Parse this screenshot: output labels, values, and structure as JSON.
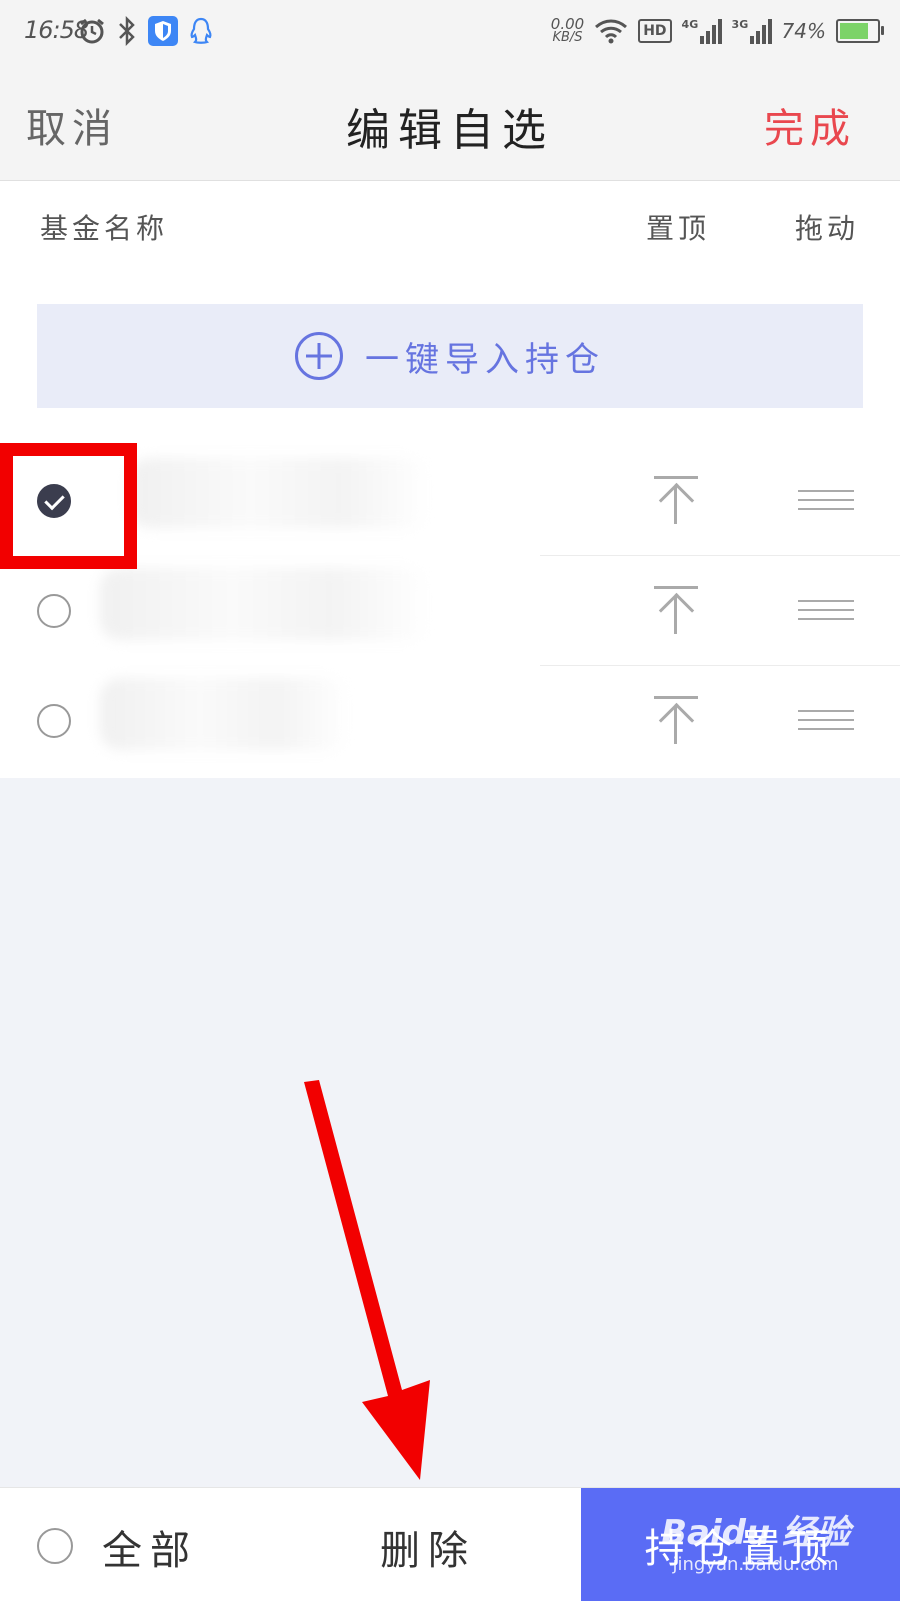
{
  "status_bar": {
    "time": "16:58",
    "net_speed_value": "0.00",
    "net_speed_unit": "KB/S",
    "hd_label": "HD",
    "signal1_label": "4G",
    "signal2_label": "3G",
    "battery_percent": "74%",
    "battery_level": 0.74,
    "icons": [
      "alarm-icon",
      "bluetooth-icon",
      "shield-app-icon",
      "qq-icon",
      "wifi-icon",
      "battery-icon"
    ]
  },
  "header": {
    "cancel_label": "取消",
    "title": "编辑自选",
    "done_label": "完成",
    "done_color": "#e9474e"
  },
  "columns": {
    "name": "基金名称",
    "pin_top": "置顶",
    "drag": "拖动"
  },
  "import_button": {
    "label": "一键导入持仓",
    "icon": "plus-circle-icon",
    "color": "#6674e0"
  },
  "rows": [
    {
      "checked": true
    },
    {
      "checked": false
    },
    {
      "checked": false
    }
  ],
  "bottom_bar": {
    "select_all_label": "全部",
    "delete_label": "删除",
    "primary_label": "持仓置顶",
    "primary_color": "#5a6cf5"
  },
  "annotations": {
    "highlight_color": "#f20000",
    "arrow_color": "#f20000"
  },
  "watermark": {
    "main": "Baidu 经验",
    "sub": "jingyan.baidu.com"
  }
}
